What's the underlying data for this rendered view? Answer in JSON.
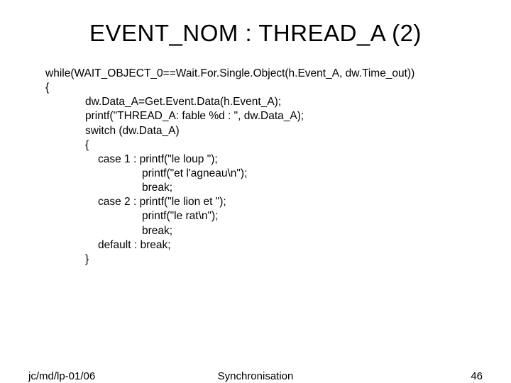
{
  "title": "EVENT_NOM : THREAD_A (2)",
  "code": {
    "l0": "while(WAIT_OBJECT_0==Wait.For.Single.Object(h.Event_A, dw.Time_out))",
    "l1": "{",
    "l2": "dw.Data_A=Get.Event.Data(h.Event_A);",
    "l3": "printf(\"THREAD_A: fable %d : \", dw.Data_A);",
    "l4": "switch (dw.Data_A)",
    "l5": "{",
    "l6": "case 1 : printf(\"le loup \");",
    "l7": "printf(\"et l'agneau\\n\");",
    "l8": "break;",
    "l9": "case 2 : printf(\"le lion et \");",
    "l10": "printf(\"le rat\\n\");",
    "l11": "break;",
    "l12": "default : break;",
    "l13": "}"
  },
  "footer": {
    "left": "jc/md/lp-01/06",
    "center": "Synchronisation",
    "right": "46"
  }
}
